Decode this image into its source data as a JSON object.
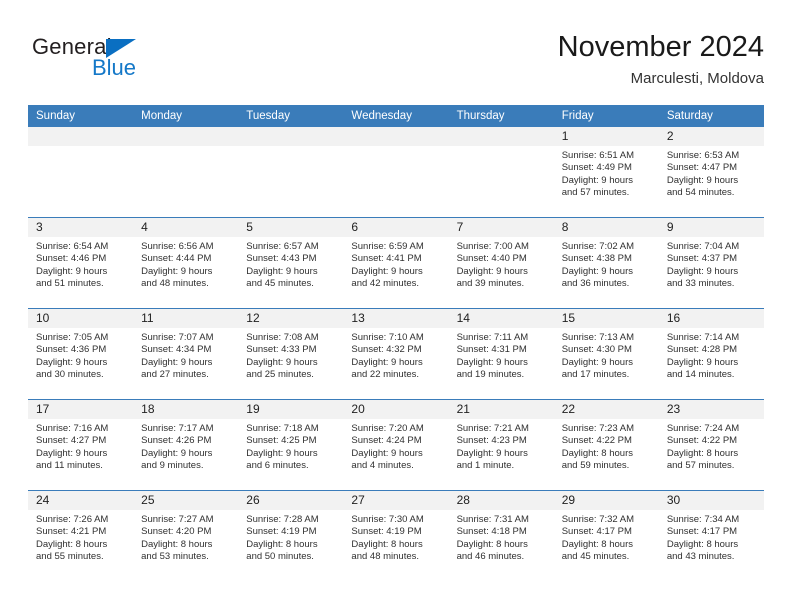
{
  "brand": {
    "name_dark": "General",
    "name_blue": "Blue",
    "accent_color": "#1478c8",
    "triangle_color": "#0a6fc2"
  },
  "header": {
    "title": "November 2024",
    "subtitle": "Marculesti, Moldova",
    "header_bg": "#3a7cba",
    "header_text_color": "#ffffff",
    "daynum_bg": "#f2f2f2"
  },
  "weekdays": [
    "Sunday",
    "Monday",
    "Tuesday",
    "Wednesday",
    "Thursday",
    "Friday",
    "Saturday"
  ],
  "labels": {
    "sunrise": "Sunrise:",
    "sunset": "Sunset:",
    "daylight": "Daylight:"
  },
  "weeks": [
    [
      {
        "day": "",
        "empty": true
      },
      {
        "day": "",
        "empty": true
      },
      {
        "day": "",
        "empty": true
      },
      {
        "day": "",
        "empty": true
      },
      {
        "day": "",
        "empty": true
      },
      {
        "day": "1",
        "sunrise": "Sunrise: 6:51 AM",
        "sunset": "Sunset: 4:49 PM",
        "daylight1": "Daylight: 9 hours",
        "daylight2": "and 57 minutes."
      },
      {
        "day": "2",
        "sunrise": "Sunrise: 6:53 AM",
        "sunset": "Sunset: 4:47 PM",
        "daylight1": "Daylight: 9 hours",
        "daylight2": "and 54 minutes."
      }
    ],
    [
      {
        "day": "3",
        "sunrise": "Sunrise: 6:54 AM",
        "sunset": "Sunset: 4:46 PM",
        "daylight1": "Daylight: 9 hours",
        "daylight2": "and 51 minutes."
      },
      {
        "day": "4",
        "sunrise": "Sunrise: 6:56 AM",
        "sunset": "Sunset: 4:44 PM",
        "daylight1": "Daylight: 9 hours",
        "daylight2": "and 48 minutes."
      },
      {
        "day": "5",
        "sunrise": "Sunrise: 6:57 AM",
        "sunset": "Sunset: 4:43 PM",
        "daylight1": "Daylight: 9 hours",
        "daylight2": "and 45 minutes."
      },
      {
        "day": "6",
        "sunrise": "Sunrise: 6:59 AM",
        "sunset": "Sunset: 4:41 PM",
        "daylight1": "Daylight: 9 hours",
        "daylight2": "and 42 minutes."
      },
      {
        "day": "7",
        "sunrise": "Sunrise: 7:00 AM",
        "sunset": "Sunset: 4:40 PM",
        "daylight1": "Daylight: 9 hours",
        "daylight2": "and 39 minutes."
      },
      {
        "day": "8",
        "sunrise": "Sunrise: 7:02 AM",
        "sunset": "Sunset: 4:38 PM",
        "daylight1": "Daylight: 9 hours",
        "daylight2": "and 36 minutes."
      },
      {
        "day": "9",
        "sunrise": "Sunrise: 7:04 AM",
        "sunset": "Sunset: 4:37 PM",
        "daylight1": "Daylight: 9 hours",
        "daylight2": "and 33 minutes."
      }
    ],
    [
      {
        "day": "10",
        "sunrise": "Sunrise: 7:05 AM",
        "sunset": "Sunset: 4:36 PM",
        "daylight1": "Daylight: 9 hours",
        "daylight2": "and 30 minutes."
      },
      {
        "day": "11",
        "sunrise": "Sunrise: 7:07 AM",
        "sunset": "Sunset: 4:34 PM",
        "daylight1": "Daylight: 9 hours",
        "daylight2": "and 27 minutes."
      },
      {
        "day": "12",
        "sunrise": "Sunrise: 7:08 AM",
        "sunset": "Sunset: 4:33 PM",
        "daylight1": "Daylight: 9 hours",
        "daylight2": "and 25 minutes."
      },
      {
        "day": "13",
        "sunrise": "Sunrise: 7:10 AM",
        "sunset": "Sunset: 4:32 PM",
        "daylight1": "Daylight: 9 hours",
        "daylight2": "and 22 minutes."
      },
      {
        "day": "14",
        "sunrise": "Sunrise: 7:11 AM",
        "sunset": "Sunset: 4:31 PM",
        "daylight1": "Daylight: 9 hours",
        "daylight2": "and 19 minutes."
      },
      {
        "day": "15",
        "sunrise": "Sunrise: 7:13 AM",
        "sunset": "Sunset: 4:30 PM",
        "daylight1": "Daylight: 9 hours",
        "daylight2": "and 17 minutes."
      },
      {
        "day": "16",
        "sunrise": "Sunrise: 7:14 AM",
        "sunset": "Sunset: 4:28 PM",
        "daylight1": "Daylight: 9 hours",
        "daylight2": "and 14 minutes."
      }
    ],
    [
      {
        "day": "17",
        "sunrise": "Sunrise: 7:16 AM",
        "sunset": "Sunset: 4:27 PM",
        "daylight1": "Daylight: 9 hours",
        "daylight2": "and 11 minutes."
      },
      {
        "day": "18",
        "sunrise": "Sunrise: 7:17 AM",
        "sunset": "Sunset: 4:26 PM",
        "daylight1": "Daylight: 9 hours",
        "daylight2": "and 9 minutes."
      },
      {
        "day": "19",
        "sunrise": "Sunrise: 7:18 AM",
        "sunset": "Sunset: 4:25 PM",
        "daylight1": "Daylight: 9 hours",
        "daylight2": "and 6 minutes."
      },
      {
        "day": "20",
        "sunrise": "Sunrise: 7:20 AM",
        "sunset": "Sunset: 4:24 PM",
        "daylight1": "Daylight: 9 hours",
        "daylight2": "and 4 minutes."
      },
      {
        "day": "21",
        "sunrise": "Sunrise: 7:21 AM",
        "sunset": "Sunset: 4:23 PM",
        "daylight1": "Daylight: 9 hours",
        "daylight2": "and 1 minute."
      },
      {
        "day": "22",
        "sunrise": "Sunrise: 7:23 AM",
        "sunset": "Sunset: 4:22 PM",
        "daylight1": "Daylight: 8 hours",
        "daylight2": "and 59 minutes."
      },
      {
        "day": "23",
        "sunrise": "Sunrise: 7:24 AM",
        "sunset": "Sunset: 4:22 PM",
        "daylight1": "Daylight: 8 hours",
        "daylight2": "and 57 minutes."
      }
    ],
    [
      {
        "day": "24",
        "sunrise": "Sunrise: 7:26 AM",
        "sunset": "Sunset: 4:21 PM",
        "daylight1": "Daylight: 8 hours",
        "daylight2": "and 55 minutes."
      },
      {
        "day": "25",
        "sunrise": "Sunrise: 7:27 AM",
        "sunset": "Sunset: 4:20 PM",
        "daylight1": "Daylight: 8 hours",
        "daylight2": "and 53 minutes."
      },
      {
        "day": "26",
        "sunrise": "Sunrise: 7:28 AM",
        "sunset": "Sunset: 4:19 PM",
        "daylight1": "Daylight: 8 hours",
        "daylight2": "and 50 minutes."
      },
      {
        "day": "27",
        "sunrise": "Sunrise: 7:30 AM",
        "sunset": "Sunset: 4:19 PM",
        "daylight1": "Daylight: 8 hours",
        "daylight2": "and 48 minutes."
      },
      {
        "day": "28",
        "sunrise": "Sunrise: 7:31 AM",
        "sunset": "Sunset: 4:18 PM",
        "daylight1": "Daylight: 8 hours",
        "daylight2": "and 46 minutes."
      },
      {
        "day": "29",
        "sunrise": "Sunrise: 7:32 AM",
        "sunset": "Sunset: 4:17 PM",
        "daylight1": "Daylight: 8 hours",
        "daylight2": "and 45 minutes."
      },
      {
        "day": "30",
        "sunrise": "Sunrise: 7:34 AM",
        "sunset": "Sunset: 4:17 PM",
        "daylight1": "Daylight: 8 hours",
        "daylight2": "and 43 minutes."
      }
    ]
  ]
}
